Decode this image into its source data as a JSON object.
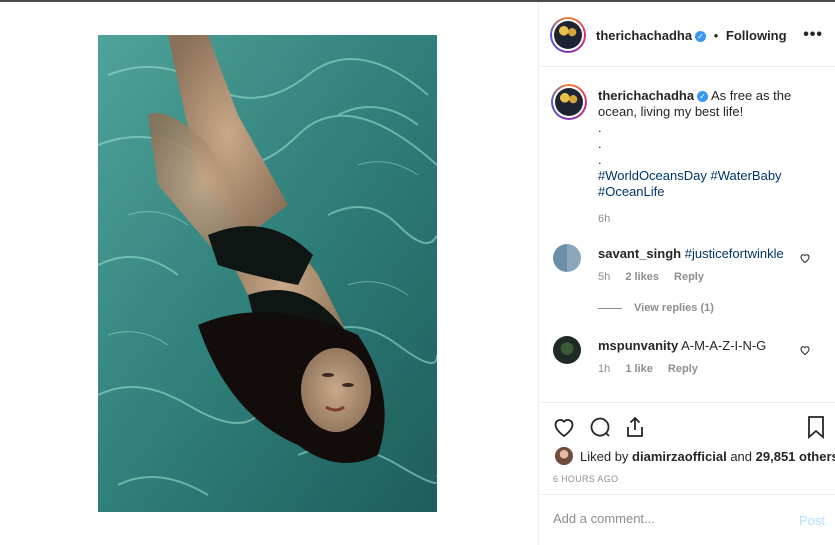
{
  "post": {
    "username": "therichachadha",
    "separator": "•",
    "follow_status": "Following",
    "more_icon": "more-horizontal-icon",
    "media_description_icon": "photo"
  },
  "caption": {
    "username": "therichachadha",
    "text": "As free as the ocean, living my best life!",
    "dots": [
      ".",
      ".",
      "."
    ],
    "hashtags": [
      "#WorldOceansDay",
      "#WaterBaby",
      "#OceanLife"
    ],
    "time": "6h"
  },
  "comments": [
    {
      "username": "savant_singh",
      "text": "#justicefortwinkle",
      "time": "5h",
      "likes": "2 likes",
      "reply": "Reply"
    },
    {
      "username": "mspunvanity",
      "text": "A-M-A-Z-I-N-G",
      "time": "1h",
      "likes": "1 like",
      "reply": "Reply"
    }
  ],
  "view_replies": "View replies (1)",
  "likes": {
    "prefix": "Liked by",
    "user": "diamirzaofficial",
    "connector": "and",
    "count": "29,851 others"
  },
  "timestamp": "6 HOURS AGO",
  "add_comment": {
    "placeholder": "Add a comment...",
    "post_label": "Post"
  },
  "colors": {
    "link": "#003569",
    "muted": "#8e8e8e",
    "verified": "#3897f0",
    "post_disabled": "#b2dffc"
  }
}
